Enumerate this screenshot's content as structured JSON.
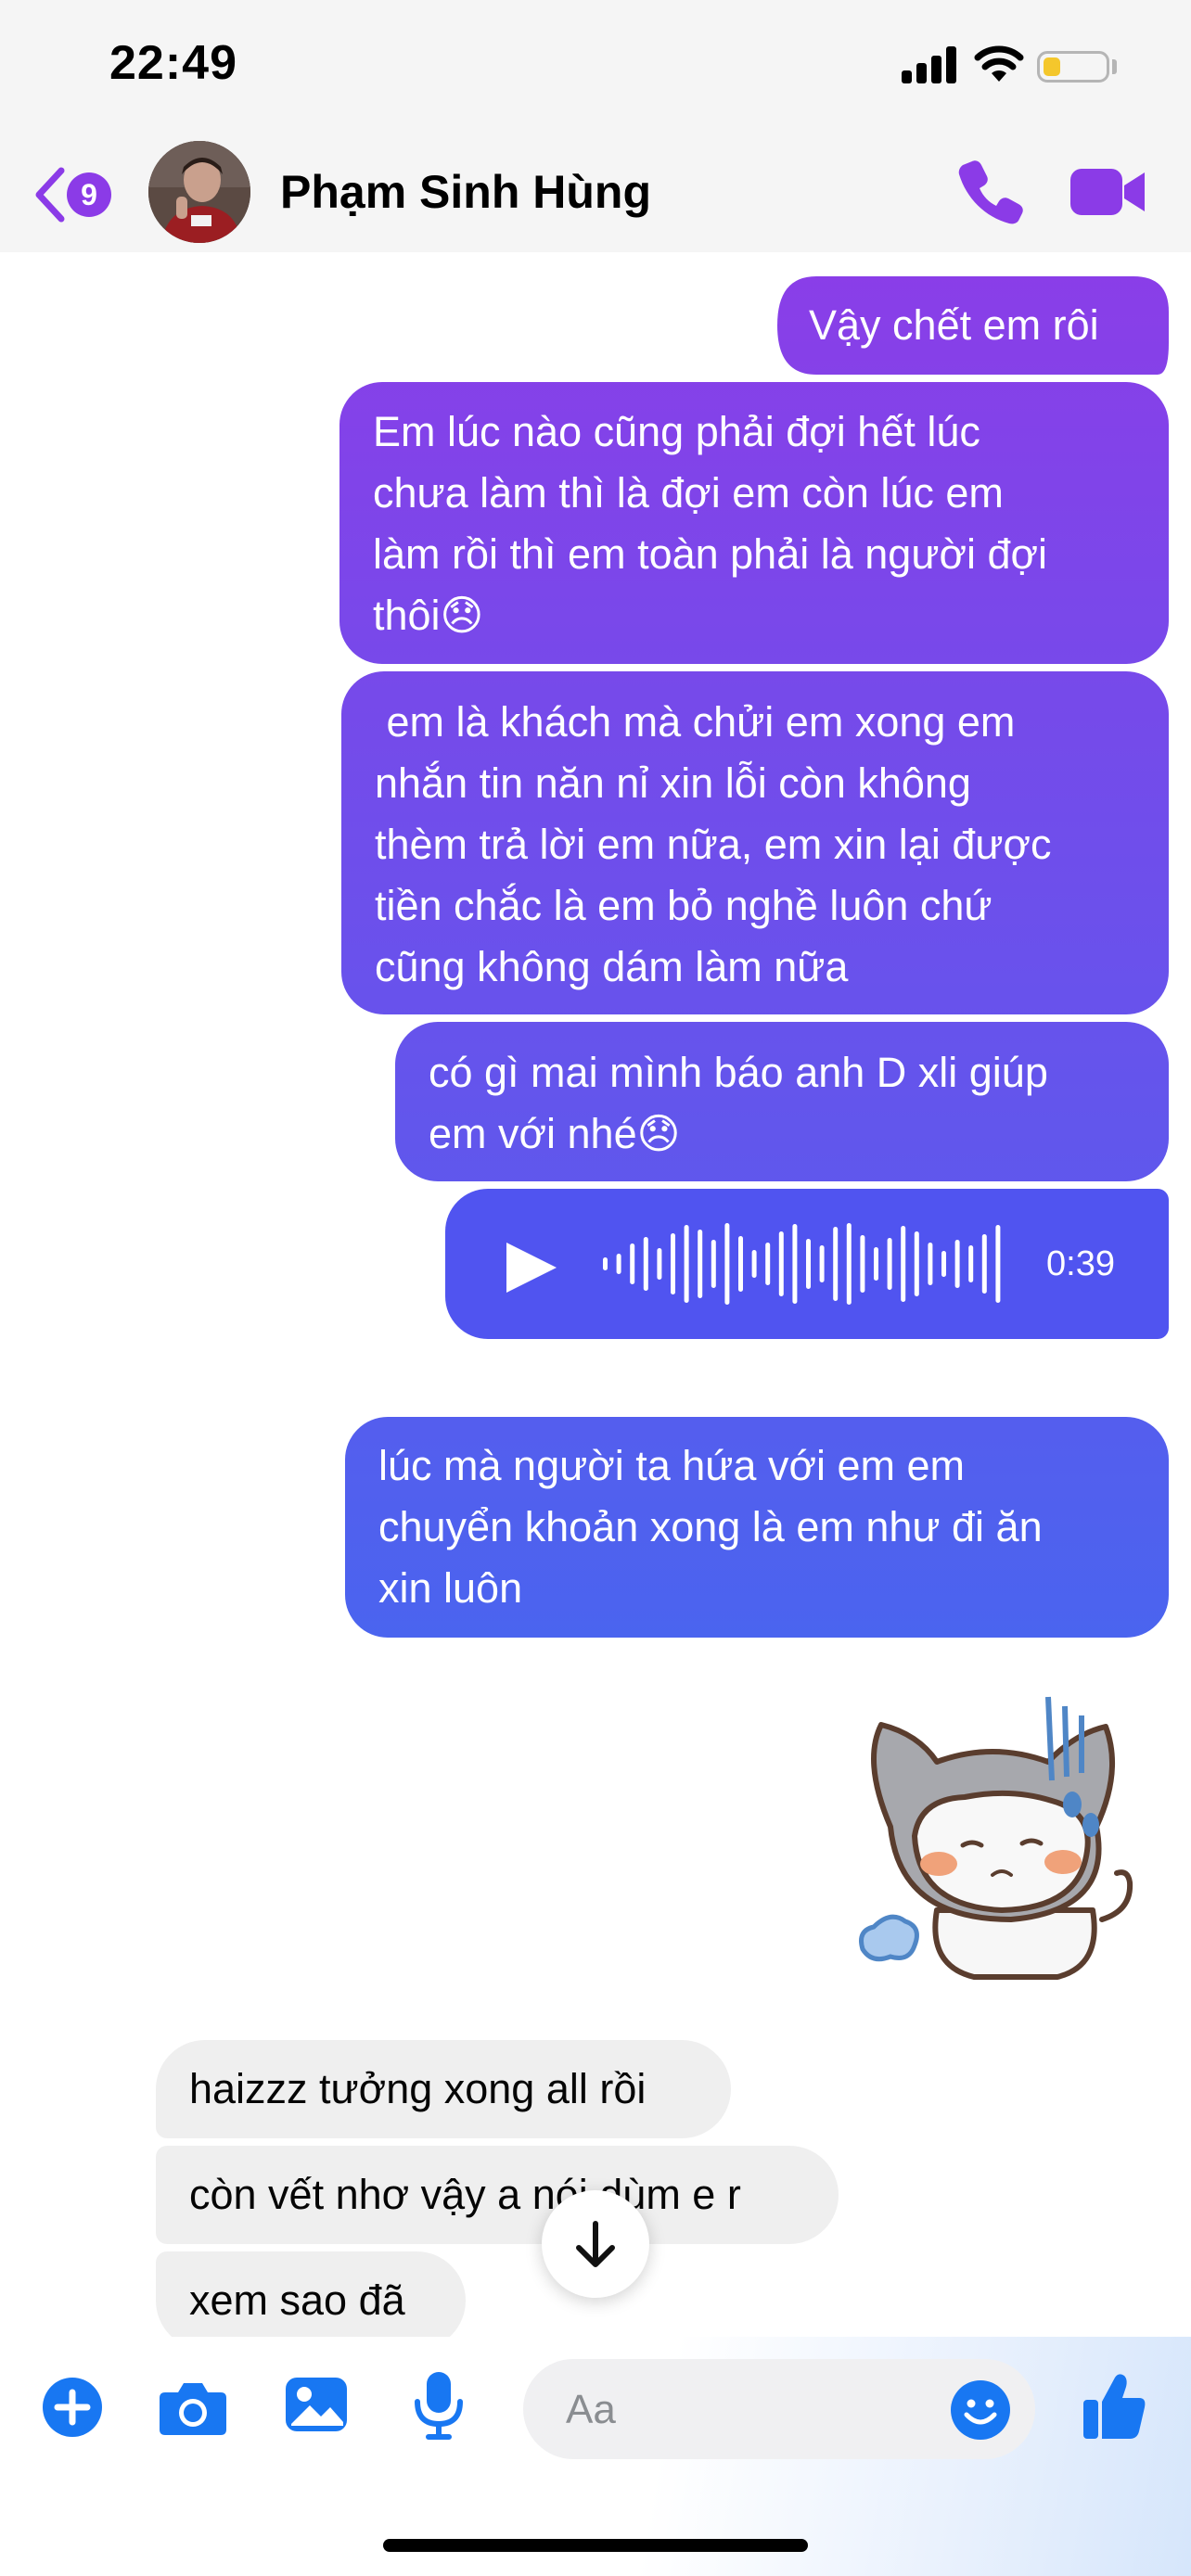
{
  "status_bar": {
    "time": "22:49"
  },
  "header": {
    "back_badge": "9",
    "contact_name": "Phạm Sinh Hùng"
  },
  "messages_out": [
    {
      "text": "Vậy chết em rôi"
    },
    {
      "text": "Em lúc nào cũng phải đợi hết lúc\nchưa làm thì là đợi em còn lúc em\nlàm rồi thì em toàn phải là người đợi\nthôi😞"
    },
    {
      "text": " em là khách mà chửi em xong em\nnhắn tin năn nỉ xin lỗi còn không\nthèm trả lời em nữa, em xin lại được\ntiền chắc là em bỏ nghề luôn chứ\ncũng không dám làm nữa"
    },
    {
      "text": "có gì mai mình báo anh D xli giúp\nem với nhé😞"
    },
    {
      "text": "lúc mà người ta hứa với em em\nchuyển khoản xong là em như đi ăn\nxin luôn"
    }
  ],
  "voice_message": {
    "duration": "0:39"
  },
  "messages_in": [
    {
      "text": "haizzz tưởng xong all rồi"
    },
    {
      "text": "còn vết nhơ vậy a nói dùm e r"
    },
    {
      "text": "xem sao đã"
    }
  ],
  "composer": {
    "placeholder": "Aa"
  },
  "colors": {
    "accent": "#8b3be7",
    "bubble_top": "#8a3ee8",
    "bubble_bottom": "#4d60f0",
    "composer_icon": "#1877f2"
  }
}
